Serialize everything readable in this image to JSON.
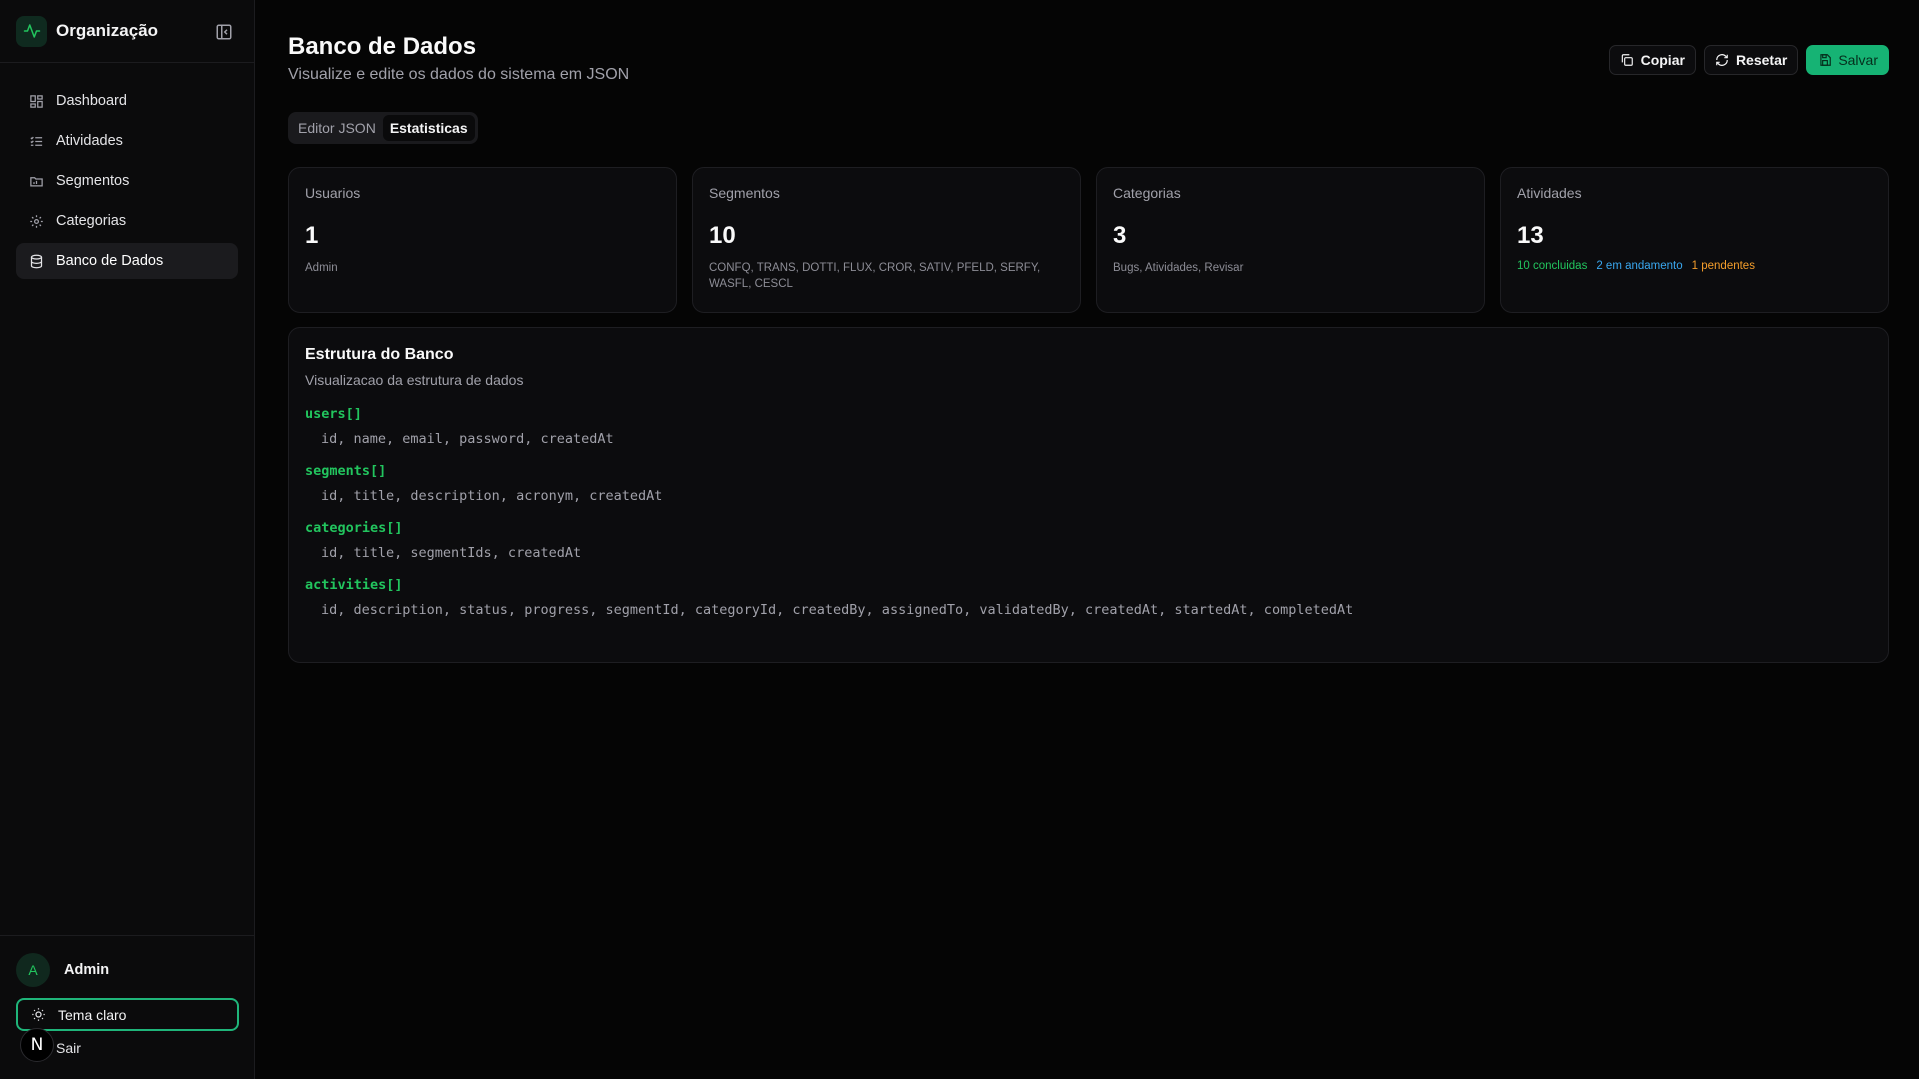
{
  "sidebar": {
    "org_name": "Organização",
    "items": [
      {
        "label": "Dashboard",
        "icon": "dashboard-icon"
      },
      {
        "label": "Atividades",
        "icon": "list-icon"
      },
      {
        "label": "Segmentos",
        "icon": "folder-icon"
      },
      {
        "label": "Categorias",
        "icon": "gear-icon"
      },
      {
        "label": "Banco de Dados",
        "icon": "database-icon",
        "active": true
      }
    ],
    "user": {
      "initial": "A",
      "name": "Admin"
    },
    "theme_label": "Tema claro",
    "logout_label": "Sair",
    "badge_letter": "N"
  },
  "header": {
    "title": "Banco de Dados",
    "subtitle": "Visualize e edite os dados do sistema em JSON",
    "actions": {
      "copy": "Copiar",
      "reset": "Resetar",
      "save": "Salvar"
    }
  },
  "tabs": [
    {
      "label": "Editor JSON"
    },
    {
      "label": "Estatisticas",
      "active": true
    }
  ],
  "stats": {
    "users": {
      "label": "Usuarios",
      "value": "1",
      "sub": "Admin"
    },
    "segments": {
      "label": "Segmentos",
      "value": "10",
      "sub": "CONFQ, TRANS, DOTTI, FLUX, CROR, SATIV, PFELD, SERFY, WASFL, CESCL"
    },
    "categories": {
      "label": "Categorias",
      "value": "3",
      "sub": "Bugs, Atividades, Revisar"
    },
    "activities": {
      "label": "Atividades",
      "value": "13",
      "done": "10 concluidas",
      "in_progress": "2 em andamento",
      "pending": "1 pendentes"
    }
  },
  "structure": {
    "title": "Estrutura do Banco",
    "subtitle": "Visualizacao da estrutura de dados",
    "entities": [
      {
        "name": "users[]",
        "fields": "id, name, email, password, createdAt"
      },
      {
        "name": "segments[]",
        "fields": "id, title, description, acronym, createdAt"
      },
      {
        "name": "categories[]",
        "fields": "id, title, segmentIds, createdAt"
      },
      {
        "name": "activities[]",
        "fields": "id, description, status, progress, segmentId, categoryId, createdBy, assignedTo, validatedBy, createdAt, startedAt, completedAt"
      }
    ]
  },
  "colors": {
    "accent": "#16b374",
    "done": "#22c55e",
    "in_progress": "#3aa8f0",
    "pending": "#f59e2b",
    "background": "#050505"
  }
}
